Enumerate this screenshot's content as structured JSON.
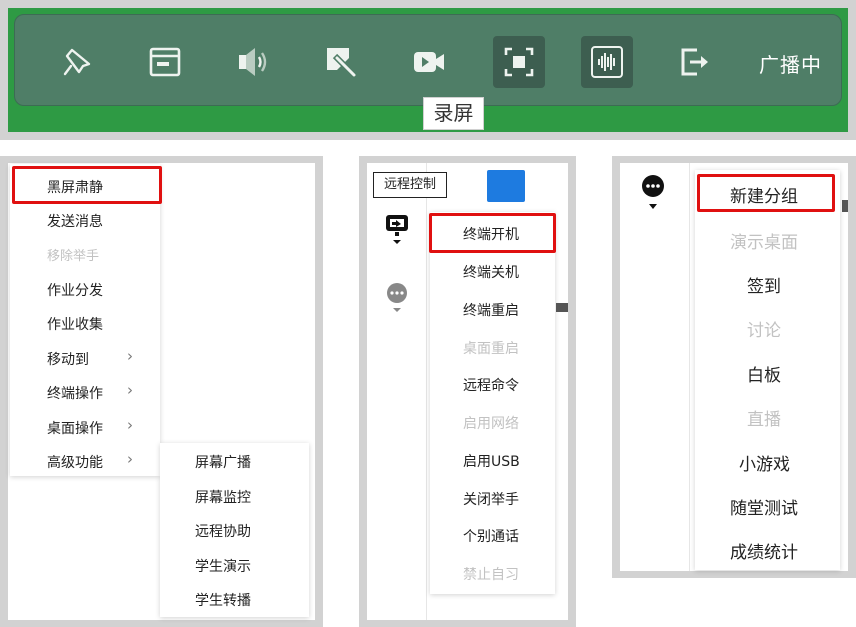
{
  "toolbar": {
    "icons": [
      "pin-icon",
      "window-icon",
      "speaker-icon",
      "magic-wand-icon",
      "video-icon",
      "screen-record-icon",
      "audio-wave-icon",
      "exit-icon"
    ],
    "status": "广播中",
    "tooltip": "录屏"
  },
  "context_menu": {
    "items": [
      {
        "label": "黑屏肃静",
        "disabled": false,
        "submenu": false,
        "highlighted": true
      },
      {
        "label": "发送消息",
        "disabled": false,
        "submenu": false
      },
      {
        "label": "移除举手",
        "disabled": true,
        "submenu": false
      },
      {
        "label": "作业分发",
        "disabled": false,
        "submenu": false
      },
      {
        "label": "作业收集",
        "disabled": false,
        "submenu": false
      },
      {
        "label": "移动到",
        "disabled": false,
        "submenu": true
      },
      {
        "label": "终端操作",
        "disabled": false,
        "submenu": true
      },
      {
        "label": "桌面操作",
        "disabled": false,
        "submenu": true
      },
      {
        "label": "高级功能",
        "disabled": false,
        "submenu": true
      }
    ],
    "submenu_items": [
      "屏幕广播",
      "屏幕监控",
      "远程协助",
      "学生演示",
      "学生转播"
    ]
  },
  "terminal_menu": {
    "tooltip": "远程控制",
    "items": [
      {
        "label": "终端开机",
        "disabled": false,
        "highlighted": true
      },
      {
        "label": "终端关机",
        "disabled": false
      },
      {
        "label": "终端重启",
        "disabled": false
      },
      {
        "label": "桌面重启",
        "disabled": true
      },
      {
        "label": "远程命令",
        "disabled": false
      },
      {
        "label": "启用网络",
        "disabled": true
      },
      {
        "label": "启用USB",
        "disabled": false
      },
      {
        "label": "关闭举手",
        "disabled": false
      },
      {
        "label": "个别通话",
        "disabled": false
      },
      {
        "label": "禁止自习",
        "disabled": true
      }
    ]
  },
  "more_menu": {
    "items": [
      {
        "label": "新建分组",
        "disabled": false,
        "highlighted": true
      },
      {
        "label": "演示桌面",
        "disabled": true
      },
      {
        "label": "签到",
        "disabled": false
      },
      {
        "label": "讨论",
        "disabled": true
      },
      {
        "label": "白板",
        "disabled": false
      },
      {
        "label": "直播",
        "disabled": true
      },
      {
        "label": "小游戏",
        "disabled": false
      },
      {
        "label": "随堂测试",
        "disabled": false
      },
      {
        "label": "成绩统计",
        "disabled": false
      }
    ]
  },
  "colors": {
    "toolbar_bg": "#4f7e67",
    "toolbar_border": "#2e9a44",
    "highlight": "#e01010",
    "disabled_text": "#c2c2c2"
  }
}
